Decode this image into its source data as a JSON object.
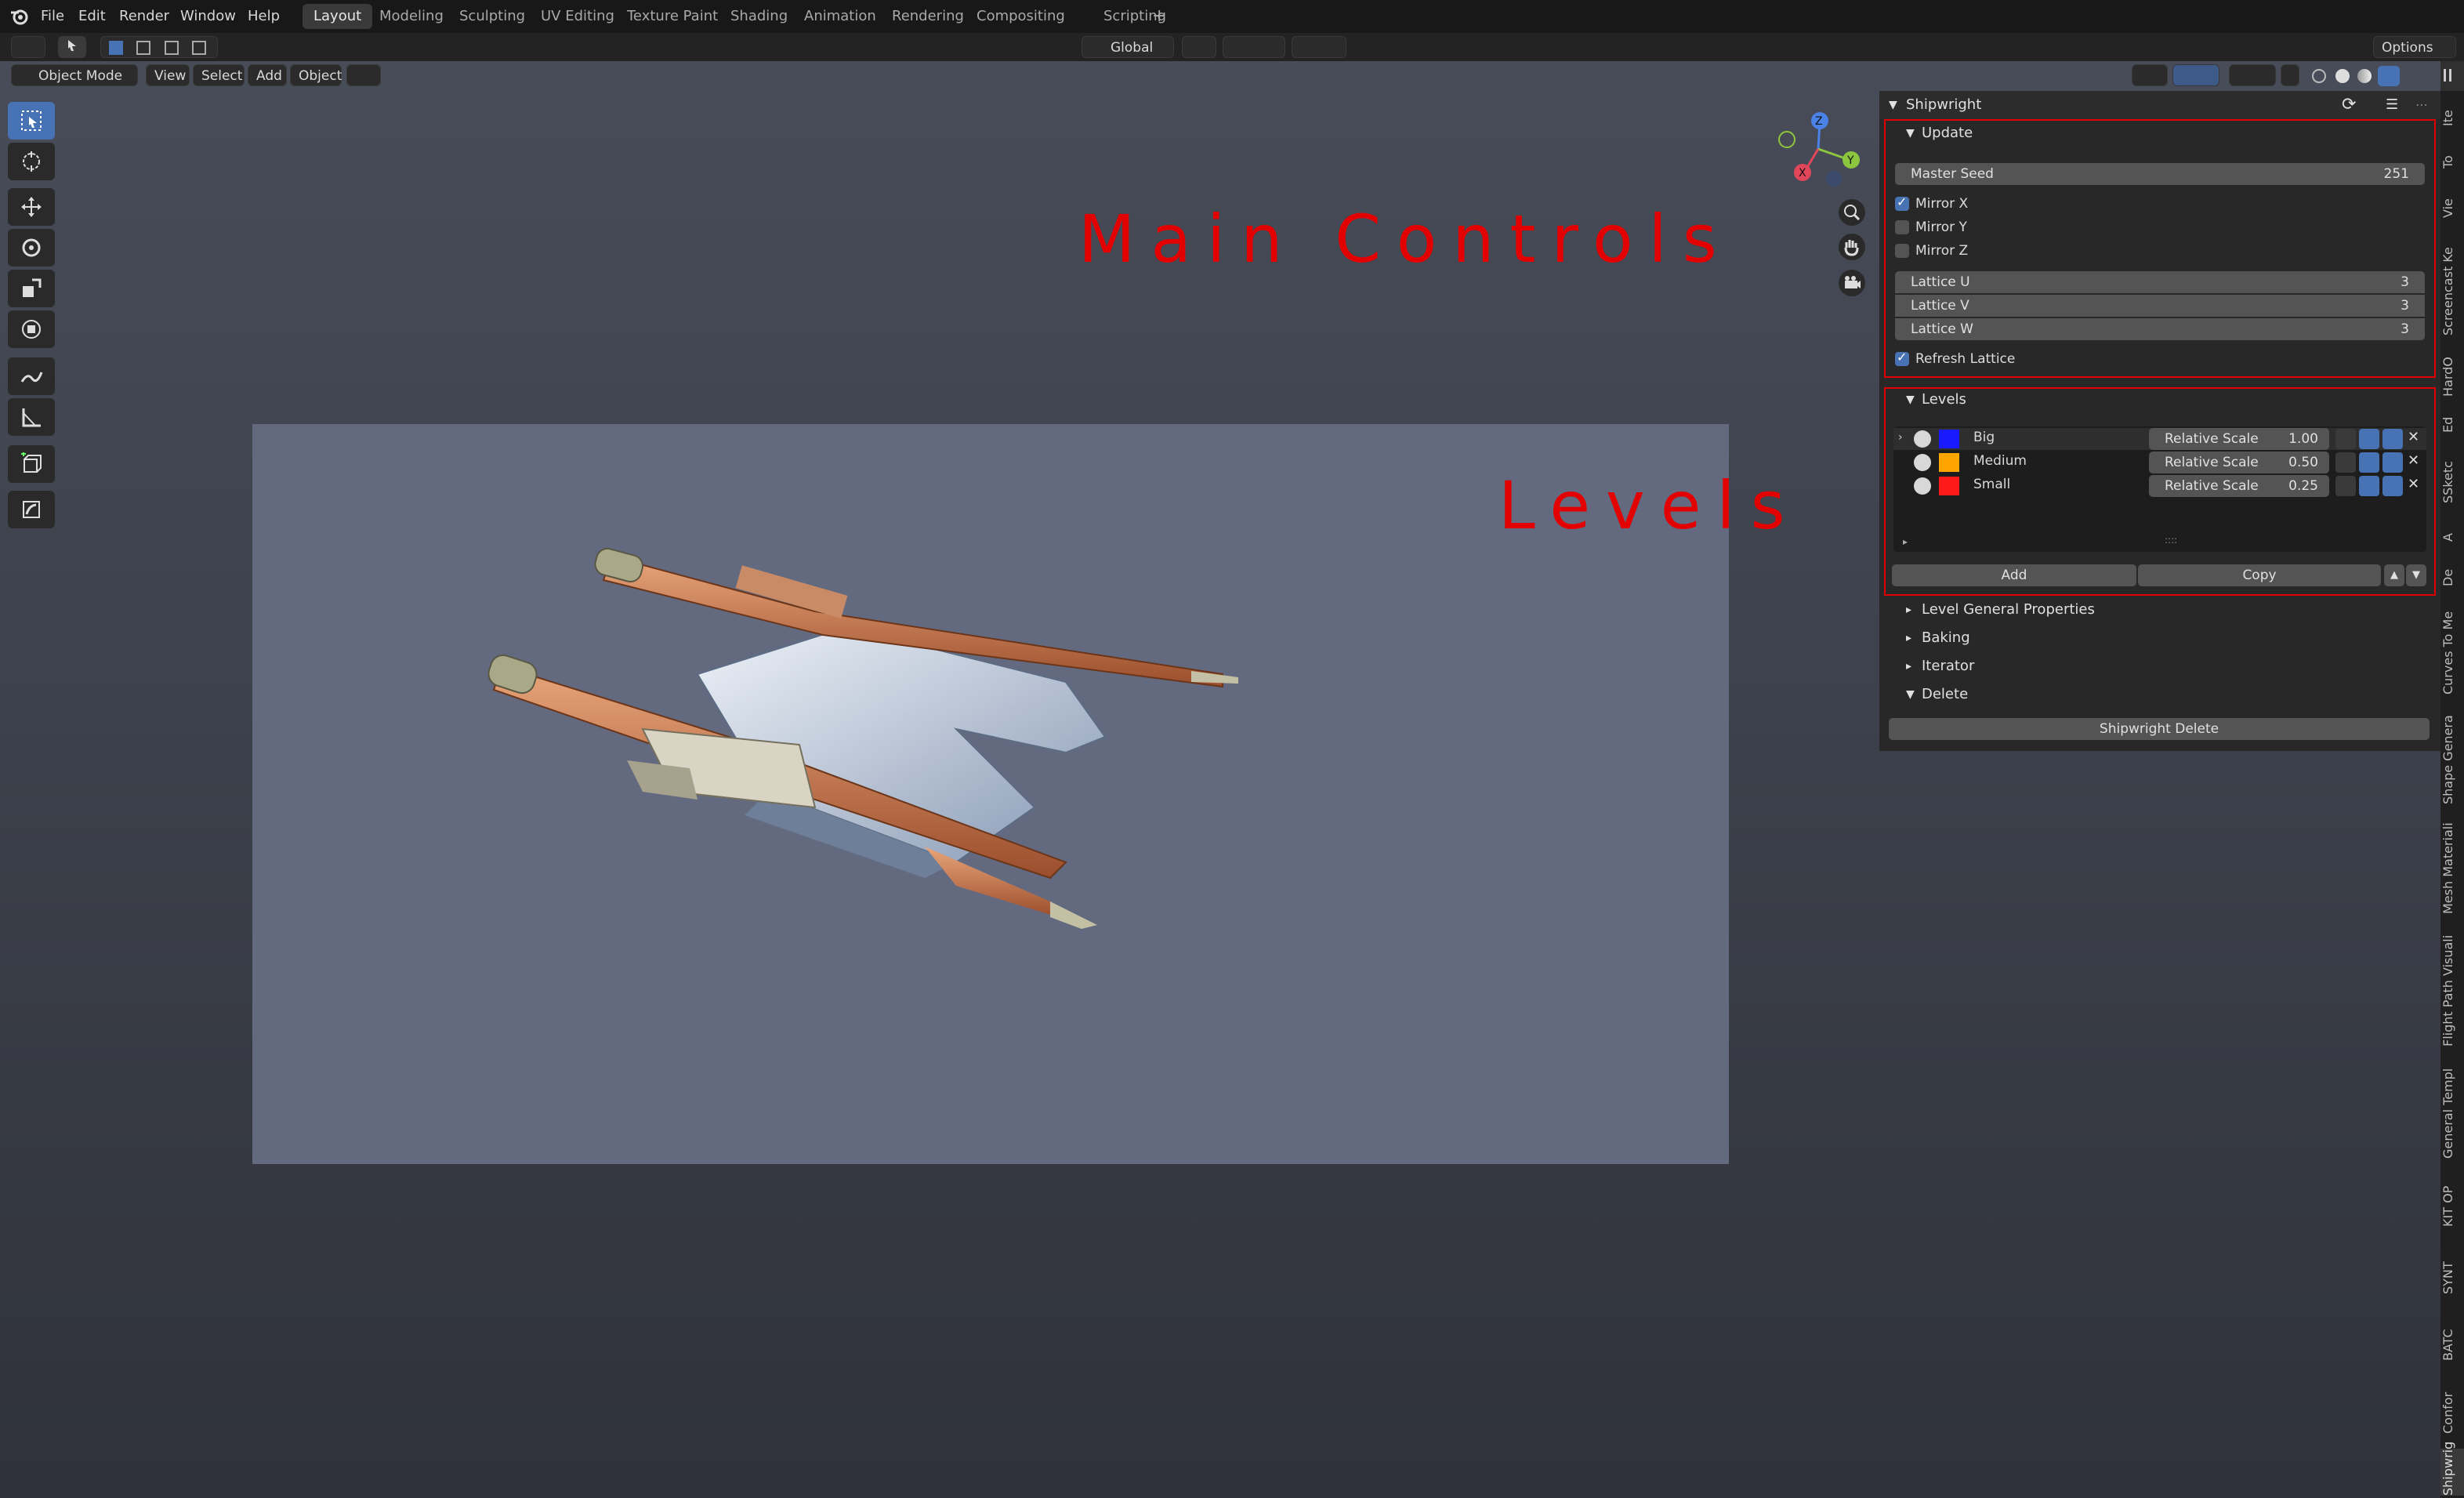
{
  "menubar": {
    "items": [
      "File",
      "Edit",
      "Render",
      "Window",
      "Help"
    ],
    "workspaces": [
      "Layout",
      "Modeling",
      "Sculpting",
      "UV Editing",
      "Texture Paint",
      "Shading",
      "Animation",
      "Rendering",
      "Compositing",
      "Scripting"
    ],
    "add_workspace": "+"
  },
  "header": {
    "transform_orientation": "Global",
    "options": "Options"
  },
  "viewport_header": {
    "mode": "Object Mode",
    "menus": [
      "View",
      "Select",
      "Add",
      "Object"
    ]
  },
  "annotations": {
    "main_controls": "Main Controls",
    "levels": "Levels"
  },
  "panel": {
    "title": "Shipwright",
    "update": {
      "title": "Update",
      "master_seed_label": "Master Seed",
      "master_seed_value": "251",
      "mirror_x": "Mirror X",
      "mirror_y": "Mirror Y",
      "mirror_z": "Mirror Z",
      "mirror_x_checked": true,
      "mirror_y_checked": false,
      "mirror_z_checked": false,
      "lattice_u_label": "Lattice U",
      "lattice_u_value": "3",
      "lattice_v_label": "Lattice V",
      "lattice_v_value": "3",
      "lattice_w_label": "Lattice W",
      "lattice_w_value": "3",
      "refresh_lattice": "Refresh Lattice",
      "refresh_lattice_checked": true
    },
    "levels": {
      "title": "Levels",
      "rows": [
        {
          "name": "Big",
          "color": "#1a1aff",
          "scale_label": "Relative Scale",
          "scale": "1.00"
        },
        {
          "name": "Medium",
          "color": "#ffa500",
          "scale_label": "Relative Scale",
          "scale": "0.50"
        },
        {
          "name": "Small",
          "color": "#ff1a1a",
          "scale_label": "Relative Scale",
          "scale": "0.25"
        }
      ],
      "add_label": "Add",
      "copy_label": "Copy",
      "grip": "::::"
    },
    "collapsed_sections": [
      "Level General Properties",
      "Baking",
      "Iterator"
    ],
    "delete": {
      "title": "Delete",
      "button": "Shipwright Delete"
    }
  },
  "side_tabs": [
    "Ite",
    "To",
    "Vie",
    "Screencast Ke",
    "HardO",
    "Ed",
    "SSketc",
    "A",
    "De",
    "Curves To Me",
    "Shape Genera",
    "Mesh Materiali",
    "Flight Path Visuali",
    "General Templ",
    "KIT OP",
    "SYNT",
    "BATC",
    "Confor",
    "Shipwrig"
  ],
  "gizmo": {
    "z": "Z",
    "y": "Y",
    "x": "X"
  }
}
